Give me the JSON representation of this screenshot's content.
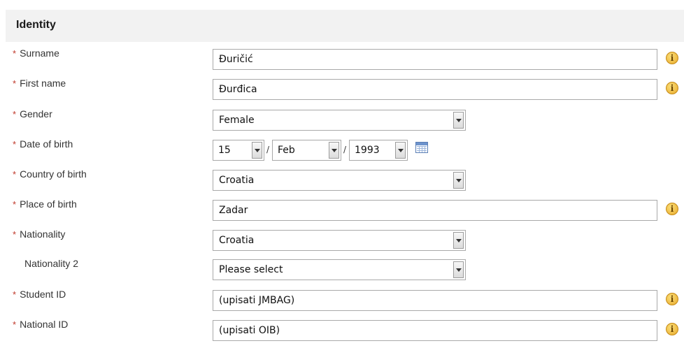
{
  "section": {
    "title": "Identity"
  },
  "required_marker": "*",
  "fields": {
    "surname": {
      "label": "Surname",
      "value": "Đuričić"
    },
    "first_name": {
      "label": "First name",
      "value": "Đurđica"
    },
    "gender": {
      "label": "Gender",
      "value": "Female"
    },
    "date_of_birth": {
      "label": "Date of birth",
      "day": "15",
      "month": "Feb",
      "year": "1993",
      "separator": "/"
    },
    "country_of_birth": {
      "label": "Country of birth",
      "value": "Croatia"
    },
    "place_of_birth": {
      "label": "Place of birth",
      "value": "Zadar"
    },
    "nationality": {
      "label": "Nationality",
      "value": "Croatia"
    },
    "nationality_2": {
      "label": "Nationality 2",
      "value": "Please select"
    },
    "student_id": {
      "label": "Student ID",
      "value": "(upisati JMBAG)"
    },
    "national_id": {
      "label": "National ID",
      "value": "(upisati OIB)"
    }
  },
  "info_icon_glyph": "i",
  "colors": {
    "required": "#c0392b",
    "header_bg": "#f2f2f2",
    "info_icon": "#e8a92a",
    "calendar_icon": "#6d93cc"
  }
}
